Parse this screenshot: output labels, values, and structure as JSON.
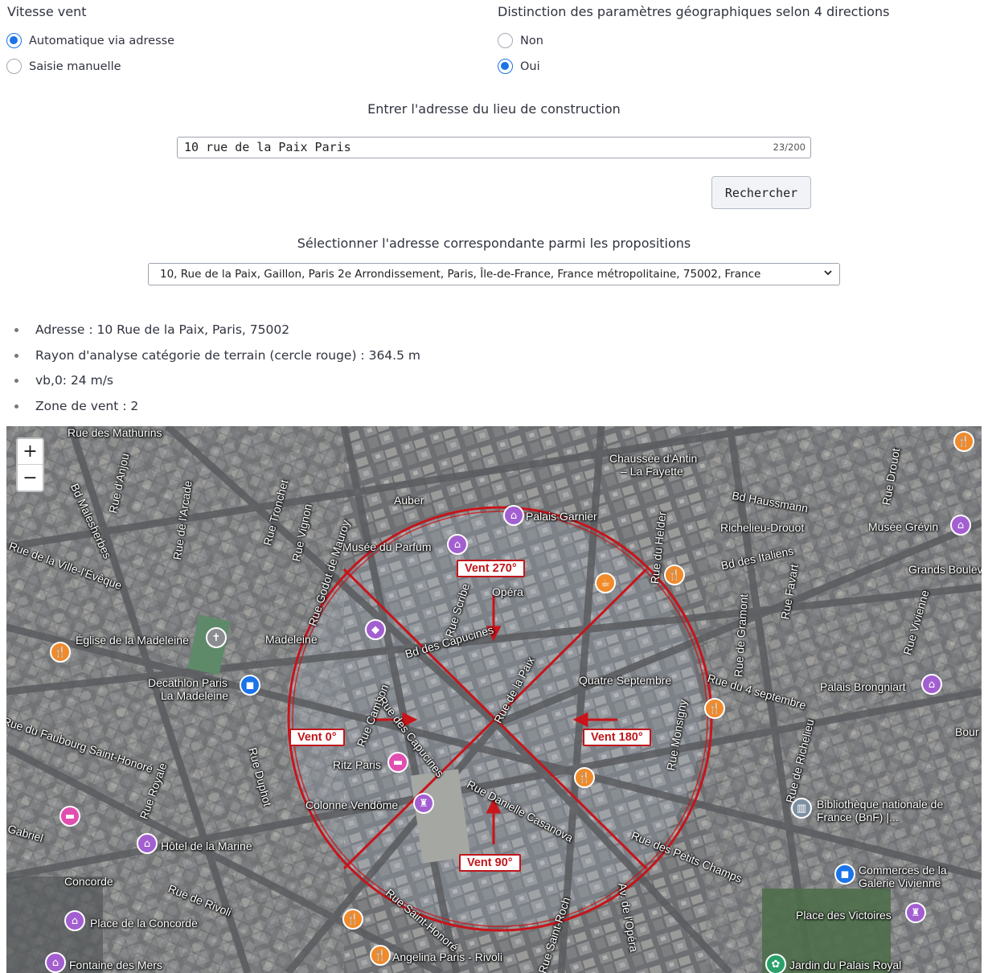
{
  "wind_speed": {
    "label": "Vitesse vent",
    "options": [
      {
        "label": "Automatique via adresse",
        "selected": true
      },
      {
        "label": "Saisie manuelle",
        "selected": false
      }
    ]
  },
  "geo_params": {
    "label": "Distinction des paramètres géographiques selon 4 directions",
    "options": [
      {
        "label": "Non",
        "selected": false
      },
      {
        "label": "Oui",
        "selected": true
      }
    ]
  },
  "address_input": {
    "label": "Entrer l'adresse du lieu de construction",
    "value": "10 rue de la Paix Paris",
    "counter": "23/200"
  },
  "search_button": {
    "label": "Rechercher"
  },
  "address_select": {
    "label": "Sélectionner l'adresse correspondante parmi les propositions",
    "selected": "10, Rue de la Paix, Gaillon, Paris 2e Arrondissement, Paris, Île-de-France, France métropolitaine, 75002, France"
  },
  "info": [
    "Adresse : 10 Rue de la Paix, Paris, 75002",
    "Rayon d'analyse catégorie de terrain (cercle rouge) : 364.5 m",
    "vb,0: 24 m/s",
    "Zone de vent : 2"
  ],
  "map": {
    "zoom_in": "+",
    "zoom_out": "−",
    "wind_labels": {
      "north": "Vent 270°",
      "west": "Vent 0°",
      "east": "Vent 180°",
      "south": "Vent 90°"
    },
    "places": {
      "rue_mathurins": "Rue des Mathurins",
      "auber": "Auber",
      "palais_garnier": "Palais Garnier",
      "chaussee": "Chaussée d'Antin",
      "lafayette": "– La Fayette",
      "bd_haussmann": "Bd Haussmann",
      "richelieu": "Richelieu-Drouot",
      "musee_grevin": "Musée Grévin",
      "musee_parfum": "Musée du Parfum",
      "opera": "Opéra",
      "bd_italiens": "Bd des Italiens",
      "grands_boul": "Grands Boulev",
      "madeleine_church": "Église de la Madeleine",
      "madeleine": "Madeleine",
      "bd_capucines": "Bd des Capucines",
      "rue_paix": "Rue de la Paix",
      "quatre_septembre": "Quatre Septembre",
      "rue_4_sept": "Rue du 4 septembre",
      "palais_brongniart": "Palais Brongniart",
      "decathlon": "Decathlon Paris",
      "la_madeleine": "La Madeleine",
      "faubourg": "Rue du Faubourg Saint-Honoré",
      "ritz": "Ritz Paris",
      "colonne": "Colonne Vendôme",
      "rue_danielle": "Rue Danielle Casanova",
      "rue_petits_champs": "Rue des Petits Champs",
      "bnf": "Bibliothèque nationale de",
      "bnf2": "France (BnF) |...",
      "hotel_marine": "Hôtel de la Marine",
      "concorde": "Concorde",
      "rue_rivoli": "Rue de Rivoli",
      "commerces": "Commerces de la",
      "galerie": "Galerie Vivienne",
      "place_concorde": "Place de la Concorde",
      "place_victoires": "Place des Victoires",
      "fontaine": "Fontaine des Mers",
      "angelina": "Angelina Paris - Rivoli",
      "jardin": "Jardin du Palais Royal",
      "rue_st_honore": "Rue Saint-Honoré",
      "bd_malesherbes": "Bd Malesherbes",
      "rue_tronchet": "Rue Tronchet",
      "rue_vignon": "Rue Vignon",
      "rue_royale": "Rue Royale",
      "rue_cambon": "Rue Cambon",
      "rue_capucines": "Rue des Capucines",
      "rue_scribe": "Rue Scribe",
      "rue_helder": "Rue du Helder",
      "rue_gramont": "Rue de Gramont",
      "rue_favart": "Rue Favart",
      "rue_richelieu": "Rue de Richelieu",
      "rue_drouot": "Rue Drouot",
      "rue_vivienne": "Rue Vivienne",
      "ville_leveque": "Rue de la Ville-l'Évêque",
      "rue_duphot": "Rue Duphot",
      "rue_anjou": "Rue d'Anjou",
      "rue_arcade": "Rue de l'Arcade",
      "godot": "Rue Godot de Mauroy",
      "rue_monsigny": "Rue Monsigny",
      "gabriel": "Gabriel",
      "rue_st_roch": "Rue Saint-Roch",
      "av_opera": "Av. de l'Opéra",
      "bour": "Bour"
    }
  }
}
